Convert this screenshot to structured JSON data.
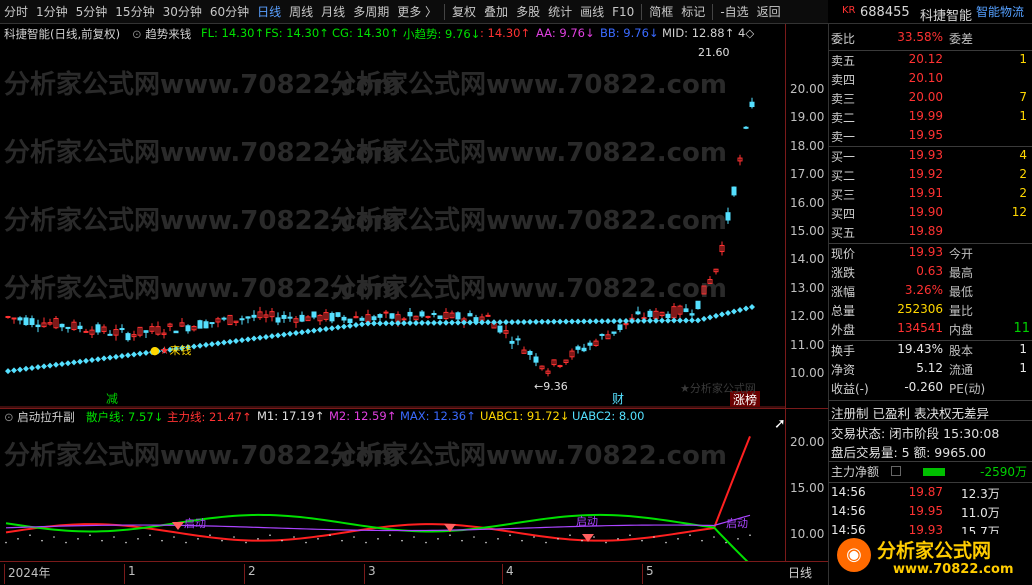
{
  "toolbar": {
    "items": [
      "分时",
      "1分钟",
      "5分钟",
      "15分钟",
      "30分钟",
      "60分钟",
      "日线",
      "周线",
      "月线",
      "多周期",
      "更多 〉",
      "复权",
      "叠加",
      "多股",
      "统计",
      "画线",
      "F10",
      "简框",
      "标记",
      "-自选",
      "返回"
    ],
    "active": "日线"
  },
  "stock": {
    "kr": "KR",
    "code": "688455",
    "name": "科捷智能",
    "tag": "智能物流"
  },
  "main_header": {
    "name": "科捷智能(日线,前复权)",
    "indicator": "趋势来钱",
    "fl": "FL: 14.30↑",
    "fs": "FS: 14.30↑",
    "cg": "CG: 14.30↑",
    "xqs": "小趋势: 9.76↓",
    "c1": ": 14.30↑",
    "aa": "AA: 9.76↓",
    "bb": "BB: 9.76↓",
    "mid": "MID: 12.88↑",
    "tail": "4◇"
  },
  "price_axis": [
    "20.00",
    "19.00",
    "18.00",
    "17.00",
    "16.00",
    "15.00",
    "14.00",
    "13.00",
    "12.00",
    "11.00",
    "10.00"
  ],
  "main_annotations": {
    "high": "21.60",
    "low": "9.36",
    "laiqian": "来钱",
    "jian": "减",
    "cai": "财",
    "zhangbang": "涨榜",
    "watermark": "分析家公式网"
  },
  "sub_header": {
    "name": "启动拉升副",
    "sanhu": "散户线: 7.57↓",
    "zhuli": "主力线: 21.47↑",
    "m1": "M1: 17.19↑",
    "m2": "M2: 12.59↑",
    "max": "MAX: 12.36↑",
    "uabc1": "UABC1: 91.72↓",
    "uabc2": "UABC2: 8.00"
  },
  "sub_axis": [
    "20.00",
    "15.00",
    "10.00"
  ],
  "sub_labels": {
    "qd1": "启动",
    "qd2": "启动",
    "qd3": "启动"
  },
  "date_axis": {
    "labels": [
      "2024年",
      "1",
      "2",
      "3",
      "4",
      "5"
    ],
    "period": "日线"
  },
  "watermark": "分析家公式网www.70822.com",
  "quote": {
    "weibi": {
      "label": "委比",
      "value": "33.58%",
      "label2": "委差"
    },
    "sell": [
      {
        "label": "卖五",
        "price": "20.12",
        "qty": "1"
      },
      {
        "label": "卖四",
        "price": "20.10",
        "qty": ""
      },
      {
        "label": "卖三",
        "price": "20.00",
        "qty": "7"
      },
      {
        "label": "卖二",
        "price": "19.99",
        "qty": "1"
      },
      {
        "label": "卖一",
        "price": "19.95",
        "qty": ""
      }
    ],
    "buy": [
      {
        "label": "买一",
        "price": "19.93",
        "qty": "4"
      },
      {
        "label": "买二",
        "price": "19.92",
        "qty": "2"
      },
      {
        "label": "买三",
        "price": "19.91",
        "qty": "2"
      },
      {
        "label": "买四",
        "price": "19.90",
        "qty": "12"
      },
      {
        "label": "买五",
        "price": "19.89",
        "qty": ""
      }
    ],
    "stats": [
      {
        "l1": "现价",
        "v1": "19.93",
        "l2": "今开",
        "c": "red"
      },
      {
        "l1": "涨跌",
        "v1": "0.63",
        "l2": "最高",
        "c": "red"
      },
      {
        "l1": "涨幅",
        "v1": "3.26%",
        "l2": "最低",
        "c": "red"
      },
      {
        "l1": "总量",
        "v1": "252306",
        "l2": "量比",
        "c": "yel"
      },
      {
        "l1": "外盘",
        "v1": "134541",
        "l2": "内盘",
        "c": "red"
      }
    ],
    "neipan_val": "11",
    "stats2": [
      {
        "l1": "换手",
        "v1": "19.43%",
        "l2": "股本",
        "v2": "1"
      },
      {
        "l1": "净资",
        "v1": "5.12",
        "l2": "流通",
        "v2": "1"
      },
      {
        "l1": "收益(-)",
        "v1": "-0.260",
        "l2": "PE(动)",
        "v2": ""
      }
    ],
    "tags": "注册制 已盈利 表决权无差异",
    "trade_status": "交易状态: 闭市阶段 15:30:08",
    "after_hours": "盘后交易量: 5 额: 9965.00",
    "main_net": {
      "label": "主力净额",
      "value": "-2590万"
    },
    "ticks": [
      {
        "time": "14:56",
        "price": "19.87",
        "vol": "12.3万"
      },
      {
        "time": "14:56",
        "price": "19.95",
        "vol": "11.0万"
      },
      {
        "time": "14:56",
        "price": "19.93",
        "vol": "15.7万"
      }
    ]
  },
  "logo": {
    "text": "分析家公式网",
    "url": "www.70822.com"
  }
}
